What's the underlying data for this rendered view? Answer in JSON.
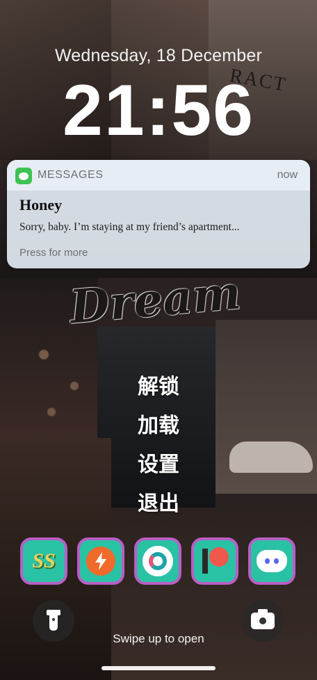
{
  "lockscreen": {
    "date": "Wednesday, 18 December",
    "time": "21:56"
  },
  "wallpaper": {
    "contract_text": "RACT",
    "dream_text": "Dream"
  },
  "notification": {
    "app_name": "MESSAGES",
    "time": "now",
    "sender": "Honey",
    "message": "Sorry, baby. I’m staying at my friend’s apartment...",
    "hint": "Press for more",
    "app_icon": "messages-icon",
    "app_color": "#3fc254"
  },
  "menu": {
    "items": [
      "解锁",
      "加载",
      "设置",
      "退出"
    ]
  },
  "dock": {
    "apps": [
      {
        "icon": "ss-app-icon",
        "label": "SS"
      },
      {
        "icon": "bolt-app-icon"
      },
      {
        "icon": "ring-app-icon"
      },
      {
        "icon": "patreon-icon"
      },
      {
        "icon": "discord-icon"
      }
    ],
    "border_color": "#b95fc4",
    "background_color": "#2ac2a4"
  },
  "controls": {
    "flashlight_icon": "flashlight-icon",
    "camera_icon": "camera-icon",
    "swipe_text": "Swipe up to open"
  }
}
